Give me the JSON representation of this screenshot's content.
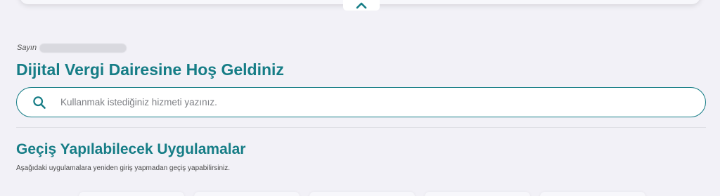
{
  "greeting": {
    "prefix": "Sayın"
  },
  "welcome": {
    "title": "Dijital Vergi Dairesine Hoş Geldiniz"
  },
  "search": {
    "placeholder": "Kullanmak istediğiniz hizmeti yazınız.",
    "value": "",
    "icon": "search-icon"
  },
  "apps_section": {
    "title": "Geçiş Yapılabilecek Uygulamalar",
    "subtitle": "Aşağıdaki uygulamalara yeniden giriş yapmadan geçiş yapabilirsiniz."
  },
  "collapse": {
    "icon": "chevron-up-icon"
  },
  "colors": {
    "accent": "#167d86",
    "background": "#f2f1f7",
    "text_muted": "#7d7f84"
  }
}
